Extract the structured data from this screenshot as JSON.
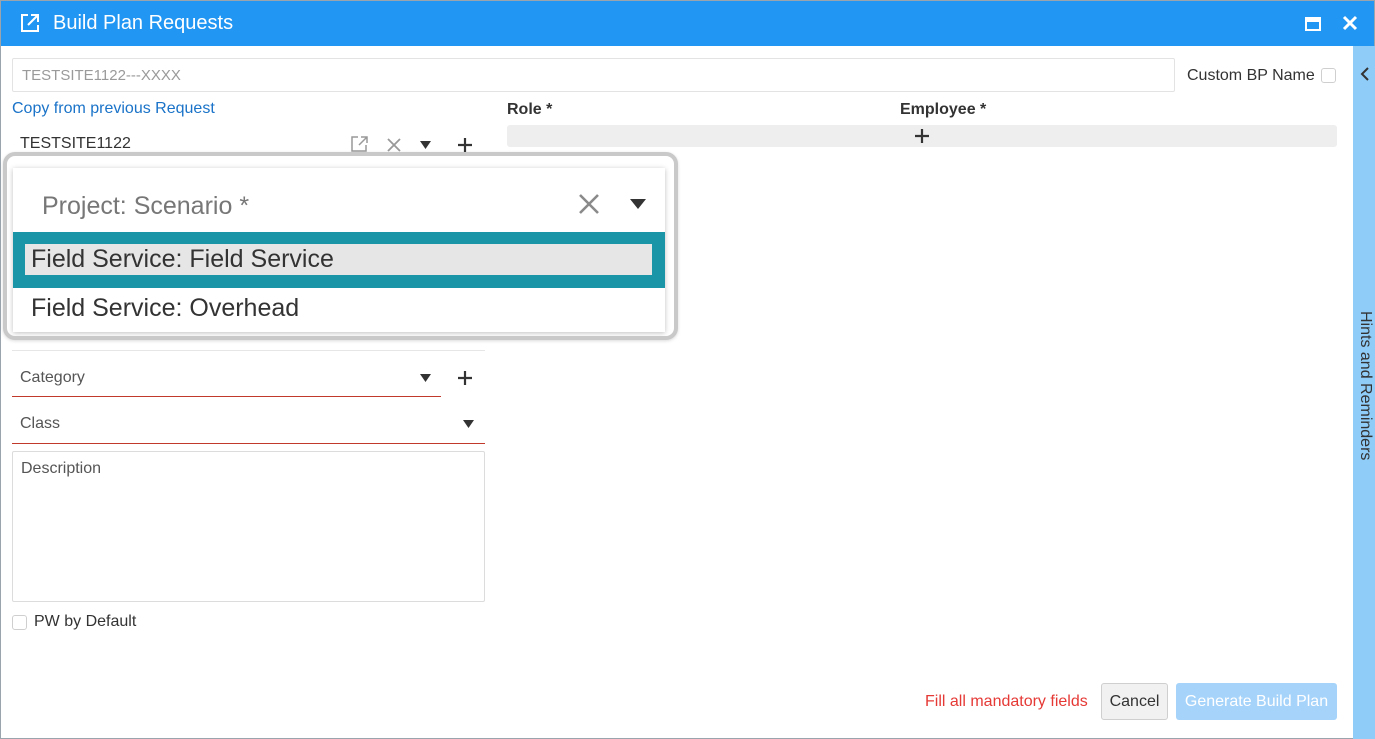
{
  "window": {
    "title": "Build Plan Requests",
    "title_bar_color": "#2196f3"
  },
  "form": {
    "bp_name_value": "TESTSITE1122---XXXX",
    "custom_bp_name_label": "Custom BP Name",
    "copy_link": "Copy from previous Request",
    "site_value": "TESTSITE1122",
    "role_header": "Role *",
    "employee_header": "Employee *",
    "category_placeholder": "Category",
    "class_placeholder": "Class",
    "description_placeholder": "Description",
    "pw_default_label": "PW by Default"
  },
  "dropdown": {
    "field_label": "Project: Scenario *",
    "options": [
      {
        "label": "Field Service: Field Service",
        "selected": true
      },
      {
        "label": "Field Service: Overhead",
        "selected": false
      }
    ],
    "highlight_color": "#1a95a8"
  },
  "footer": {
    "warning": "Fill all mandatory fields",
    "cancel_label": "Cancel",
    "generate_label": "Generate Build Plan"
  },
  "sidebar": {
    "hints_label": "Hints and Reminders",
    "color": "#90ccf8"
  },
  "icons": [
    "external-link-icon",
    "maximize-icon",
    "close-icon",
    "clear-icon",
    "chevron-down-icon",
    "plus-icon",
    "chevron-left-icon"
  ]
}
